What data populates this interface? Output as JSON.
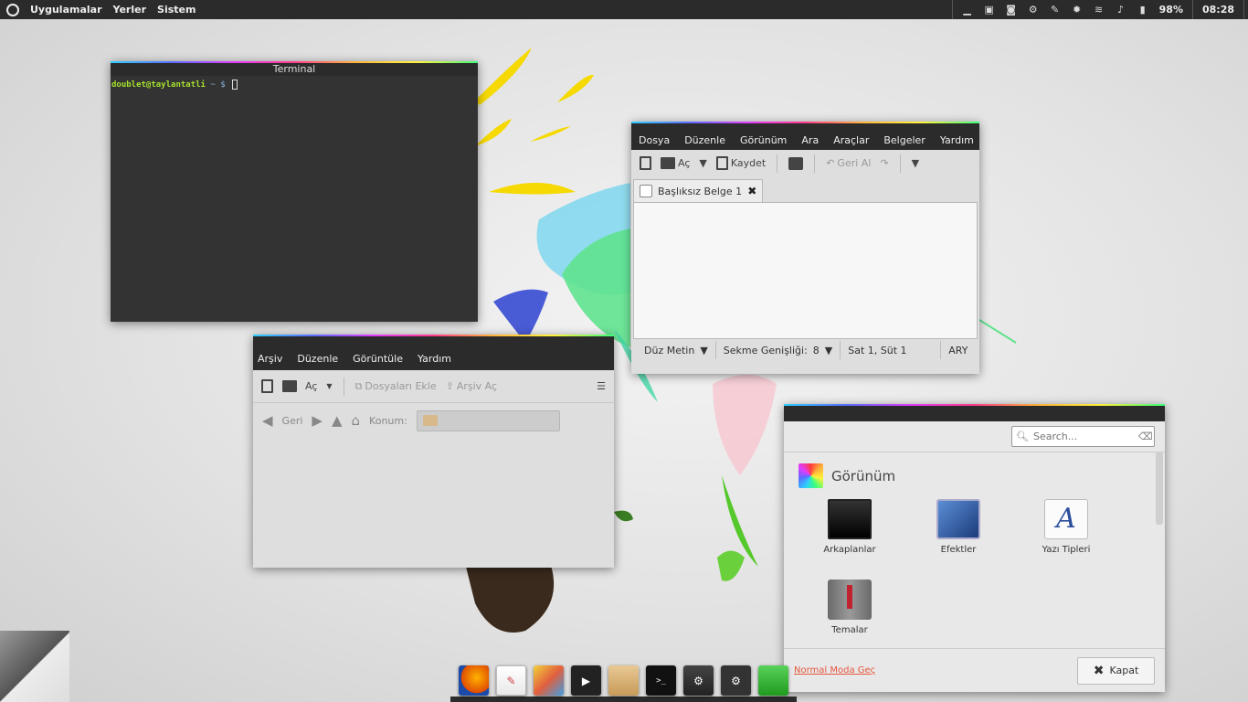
{
  "top_panel": {
    "menus": [
      "Uygulamalar",
      "Yerler",
      "Sistem"
    ],
    "battery": "98%",
    "clock": "08:28"
  },
  "terminal": {
    "title": "Terminal",
    "prompt_user": "doublet@taylantatli",
    "prompt_path": "~ $"
  },
  "gedit": {
    "menu": [
      "Dosya",
      "Düzenle",
      "Görünüm",
      "Ara",
      "Araçlar",
      "Belgeler",
      "Yardım"
    ],
    "toolbar": {
      "open": "Aç",
      "save": "Kaydet",
      "undo": "Geri Al"
    },
    "tab_title": "Başlıksız Belge 1",
    "status": {
      "mode": "Düz Metin",
      "tab_width_label": "Sekme Genişliği:",
      "tab_width": "8",
      "position": "Sat 1, Süt 1",
      "insert_mode": "ARY"
    }
  },
  "archive": {
    "menu": [
      "Arşiv",
      "Düzenle",
      "Görüntüle",
      "Yardım"
    ],
    "toolbar": {
      "open": "Aç",
      "add_files": "Dosyaları Ekle",
      "open_archive": "Arşiv Aç"
    },
    "nav": {
      "back": "Geri",
      "location_label": "Konum:"
    }
  },
  "appearance": {
    "search_placeholder": "Search...",
    "section_title": "Görünüm",
    "applets": [
      "Arkaplanlar",
      "Efektler",
      "Yazı Tipleri",
      "Temalar"
    ],
    "footer_link": "Normal Moda Geç",
    "close": "Kapat"
  },
  "dock": [
    "firefox",
    "gedit",
    "paint",
    "video",
    "files",
    "terminal",
    "steam",
    "settings",
    "green"
  ]
}
